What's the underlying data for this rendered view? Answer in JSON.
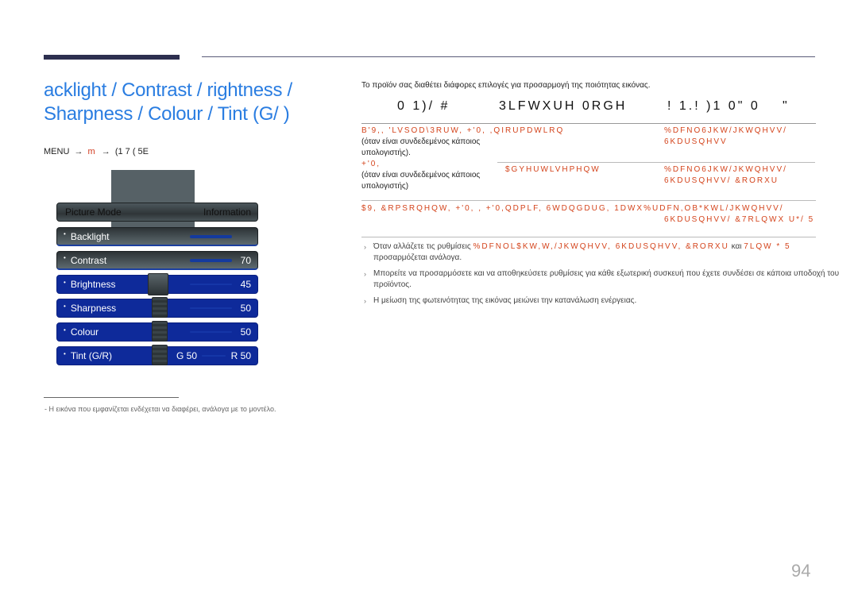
{
  "header": {
    "title_line1": "acklight / Contrast /    rightness /",
    "title_line2": "Sharpness / Colour / Tint (G/   )"
  },
  "breadcrumb": {
    "part1": "MENU",
    "arrow": "→",
    "part2": "m",
    "part3": "(1 7 ( 5E"
  },
  "osd": {
    "header_left": "Picture Mode",
    "header_right": "Information",
    "items": [
      {
        "label": "Backlight",
        "value": "",
        "style": "dark",
        "percent": 100
      },
      {
        "label": "Contrast",
        "value": "70",
        "style": "dark",
        "percent": 70
      },
      {
        "label": "Brightness",
        "value": "45",
        "style": "blue",
        "percent": 45
      },
      {
        "label": "Sharpness",
        "value": "50",
        "style": "blue",
        "percent": 50
      },
      {
        "label": "Colour",
        "value": "50",
        "style": "blue",
        "percent": 50
      },
      {
        "label": "Tint (G/R)",
        "value_left": "G 50",
        "value": "R 50",
        "style": "blue",
        "percent": 50
      }
    ],
    "bullet": "•"
  },
  "footnote": "-  Η εικόνα που εμφανίζεται ενδέχεται να διαφέρει, ανάλογα με το μοντέλο.",
  "intro": "Το προϊόν σας διαθέτει διάφορες επιλογές για προσαρμογή της ποιότητας εικόνας.",
  "table": {
    "headers": [
      "0 1)/ #",
      "3LFWXUH 0RGH",
      "! 1.! )1  0\" 0",
      "\""
    ],
    "rows": [
      {
        "col1_red": "B'9,, 'LVSOD\\3RUW, +'0, ,QIRUPDWLRQ",
        "col1_text": "(όταν είναι συνδεδεμένος κάποιος υπολογιστής).",
        "col1_red2": "+'0,",
        "col1_text2": "(όταν είναι συνδεδεμένος κάποιος υπολογιστής)",
        "col3": "%DFNO6JKW/JKWQHVV/ 6KDUSQHVV"
      },
      {
        "col2": "$GYHUWLVHPHQW",
        "col3": "%DFNO6JKW/JKWQHVV/ 6KDUSQHVV/ &RORXU"
      },
      {
        "col1": "$9, &RPSRQHQW, +'0, , +'0,QDPLF, 6WDQGDUG, 1DWX%UDFN,OB*KWL/JKWQHVV/",
        "col3": "6KDUSQHVV/ &7RLQWX U*/ 5"
      }
    ]
  },
  "notes": [
    {
      "text_a": "Όταν αλλάζετε τις ρυθμίσεις ",
      "red": "%DFNOL$KW,W,/JKWQHVV, 6KDUSQHVV, &RORXU",
      "text_b": " και ",
      "red2": "7LQW *  5",
      "text_c": "προσαρμόζεται ανάλογα."
    },
    {
      "text": "Μπορείτε να προσαρμόσετε και να αποθηκεύσετε ρυθμίσεις για κάθε εξωτερική συσκευή που έχετε συνδέσει σε κάποια υποδοχή του προϊόντος."
    },
    {
      "text": "Η μείωση της φωτεινότητας της εικόνας μειώνει την κατανάλωση ενέργειας."
    }
  ],
  "page_number": "94"
}
